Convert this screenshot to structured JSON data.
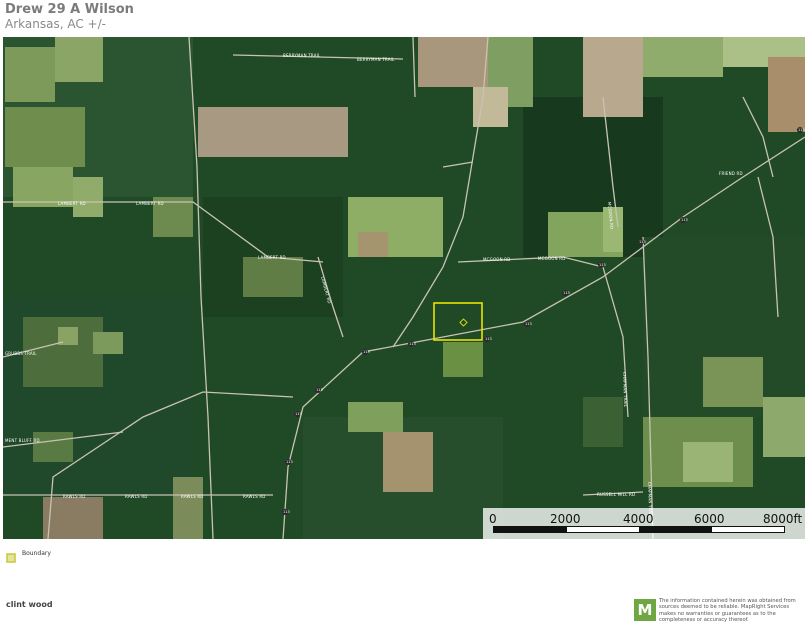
{
  "header": {
    "title": "Drew 29 A Wilson",
    "subtitle": "Arkansas,  AC +/-"
  },
  "map": {
    "road_labels": [
      "BERRYMAN TRAIL",
      "BERRYMAN TRAIL",
      "LAMBERT RD",
      "LAMBERT RD",
      "LAMBERT RD",
      "LAMBERT RD",
      "RAWLS RD",
      "RAWLS RD",
      "RAWLS RD",
      "RAWLS RD",
      "RUSSELL MILL RD",
      "GRUBBS TRAIL",
      "MENT BLUFF RD",
      "CHAPMAN TRAIL",
      "CHAPMAN TRAIL",
      "MCGOON RD",
      "MCGOON RD",
      "MCGOON RD",
      "FRIEND RD"
    ],
    "highway_shields": [
      "113",
      "113",
      "113",
      "113",
      "113",
      "113",
      "113",
      "113",
      "113",
      "113",
      "113",
      "113",
      "113"
    ],
    "boundary_color": "#e8e500"
  },
  "scale": {
    "ticks": [
      "0",
      "2000",
      "4000",
      "6000",
      "8000ft"
    ]
  },
  "legend": {
    "boundary_label": "Boundary",
    "swatch_color": "#c8c832"
  },
  "footer": {
    "author": "clint wood",
    "logo_letter": "M",
    "disclaimer": "The information contained herein was obtained from sources deemed to be reliable. MapRight Services makes no warranties or guarantees as to the completeness or accuracy thereof."
  }
}
